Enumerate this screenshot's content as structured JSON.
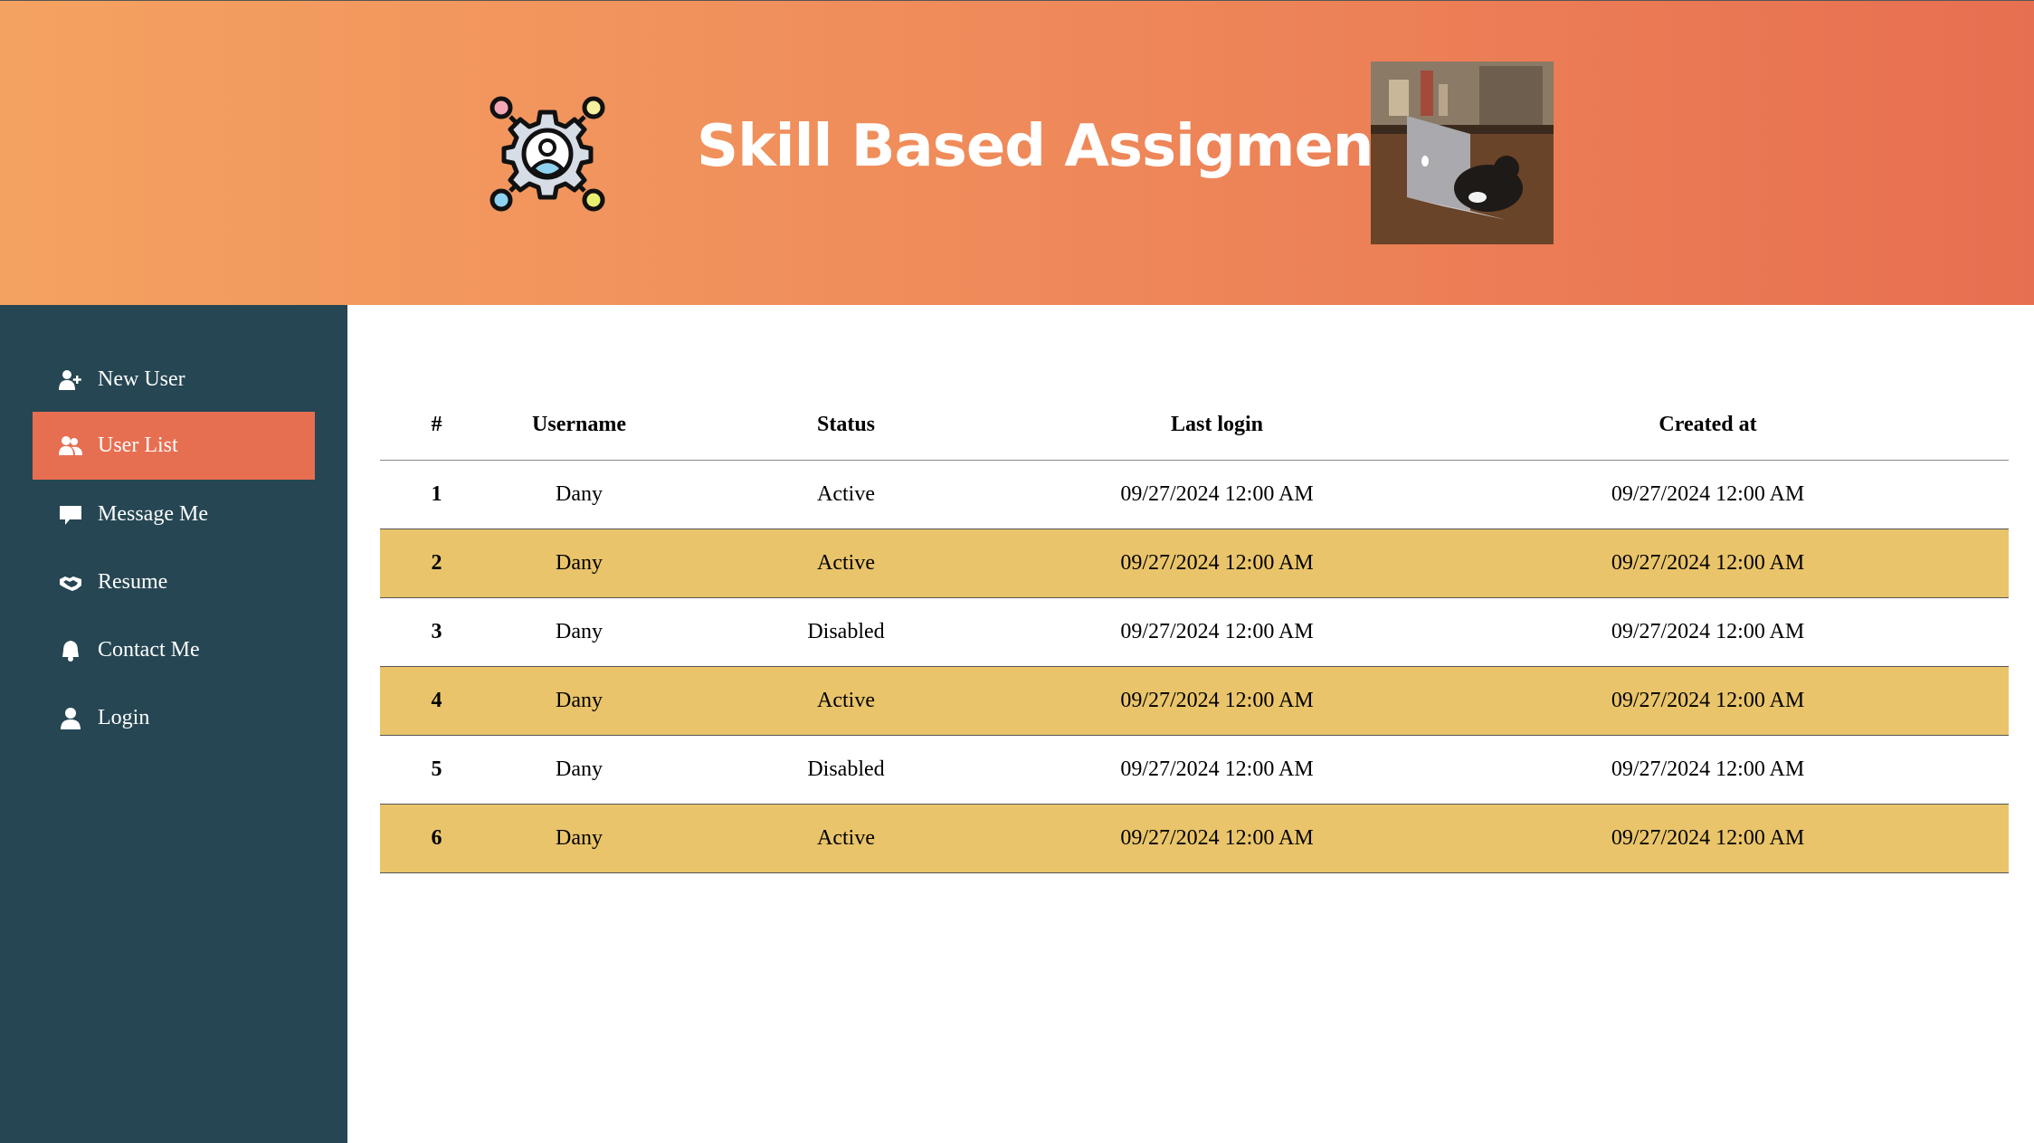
{
  "header": {
    "title": "Skill Based Assigment",
    "logo_icon": "gear-user-network-icon",
    "photo": "cat-on-laptop-photo"
  },
  "sidebar": {
    "items": [
      {
        "label": "New User",
        "icon": "user-plus-icon",
        "active": false
      },
      {
        "label": "User List",
        "icon": "users-icon",
        "active": true
      },
      {
        "label": "Message Me",
        "icon": "comment-icon",
        "active": false
      },
      {
        "label": "Resume",
        "icon": "handshake-icon",
        "active": false
      },
      {
        "label": "Contact Me",
        "icon": "bell-icon",
        "active": false
      },
      {
        "label": "Login",
        "icon": "user-icon",
        "active": false
      }
    ]
  },
  "table": {
    "columns": [
      "#",
      "Username",
      "Status",
      "Last login",
      "Created at"
    ],
    "rows": [
      {
        "num": "1",
        "username": "Dany",
        "status": "Active",
        "last_login": "09/27/2024 12:00 AM",
        "created_at": "09/27/2024 12:00 AM"
      },
      {
        "num": "2",
        "username": "Dany",
        "status": "Active",
        "last_login": "09/27/2024 12:00 AM",
        "created_at": "09/27/2024 12:00 AM"
      },
      {
        "num": "3",
        "username": "Dany",
        "status": "Disabled",
        "last_login": "09/27/2024 12:00 AM",
        "created_at": "09/27/2024 12:00 AM"
      },
      {
        "num": "4",
        "username": "Dany",
        "status": "Active",
        "last_login": "09/27/2024 12:00 AM",
        "created_at": "09/27/2024 12:00 AM"
      },
      {
        "num": "5",
        "username": "Dany",
        "status": "Disabled",
        "last_login": "09/27/2024 12:00 AM",
        "created_at": "09/27/2024 12:00 AM"
      },
      {
        "num": "6",
        "username": "Dany",
        "status": "Active",
        "last_login": "09/27/2024 12:00 AM",
        "created_at": "09/27/2024 12:00 AM"
      }
    ]
  },
  "colors": {
    "header_start": "#f4a261",
    "header_end": "#e76f51",
    "sidebar_bg": "#264653",
    "active_item": "#e76f51",
    "alt_row": "#e9c46a"
  }
}
